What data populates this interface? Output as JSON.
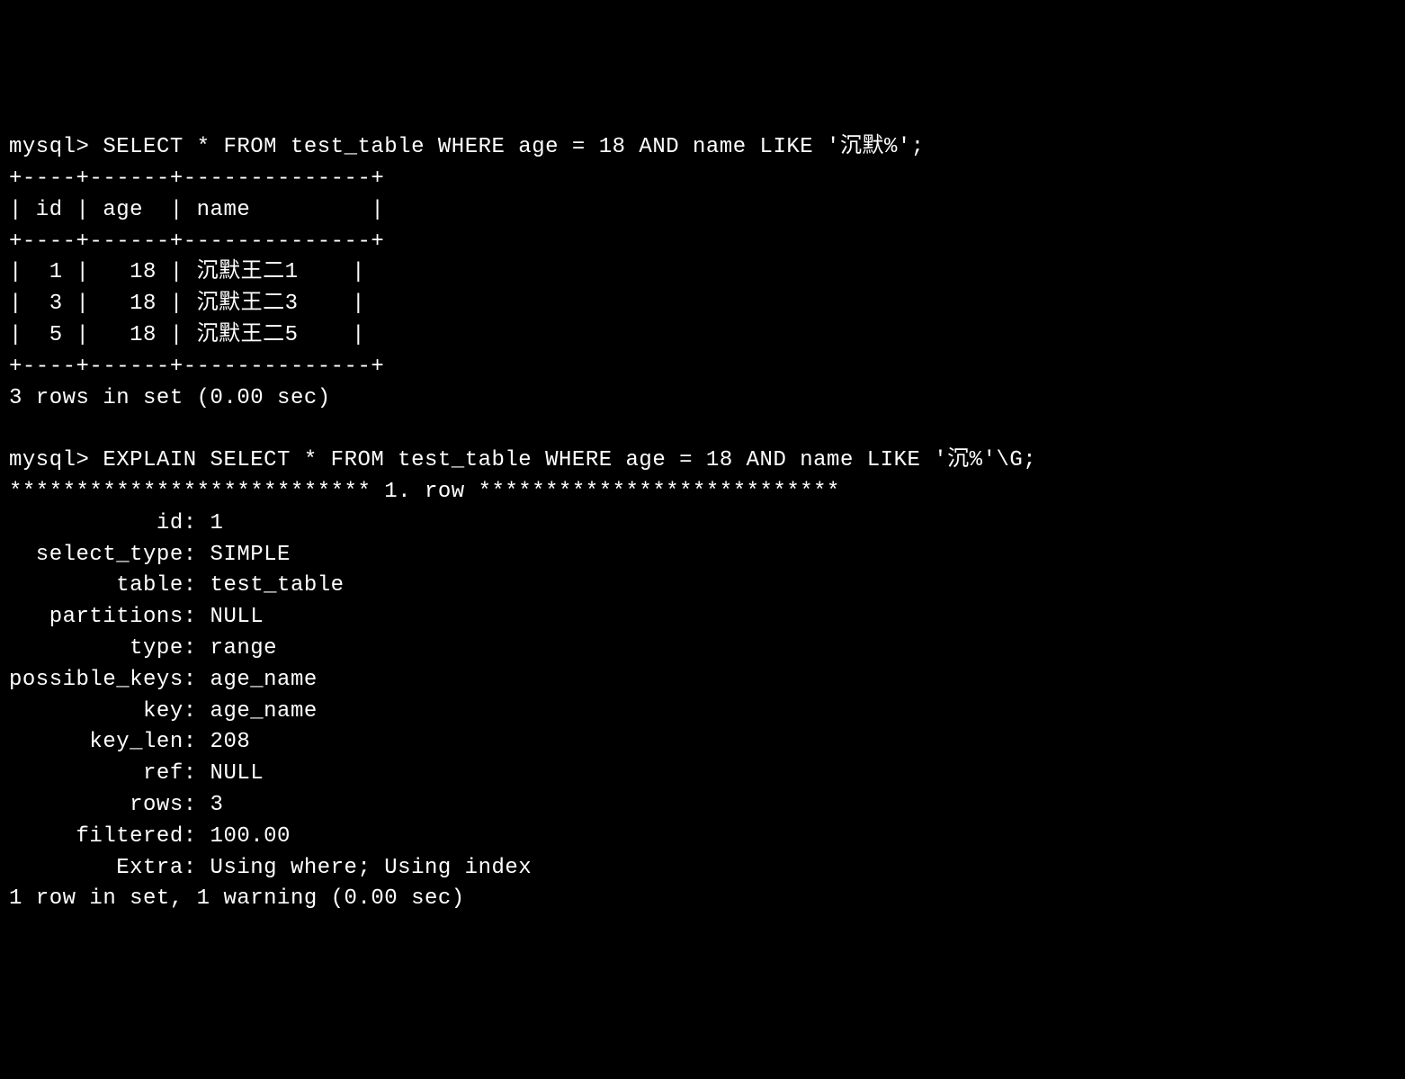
{
  "query1": {
    "prompt": "mysql> ",
    "sql": "SELECT * FROM test_table WHERE age = 18 AND name LIKE '沉默%';",
    "table": {
      "border_top": "+----+------+--------------+",
      "header": "| id | age  | name         |",
      "border_mid": "+----+------+--------------+",
      "rows": [
        "|  1 |   18 | 沉默王二1    |",
        "|  3 |   18 | 沉默王二3    |",
        "|  5 |   18 | 沉默王二5    |"
      ],
      "border_bot": "+----+------+--------------+"
    },
    "summary": "3 rows in set (0.00 sec)"
  },
  "query2": {
    "prompt": "mysql> ",
    "sql": "EXPLAIN SELECT * FROM test_table WHERE age = 18 AND name LIKE '沉%'\\G;",
    "row_header": "*************************** 1. row ***************************",
    "fields": [
      "           id: 1",
      "  select_type: SIMPLE",
      "        table: test_table",
      "   partitions: NULL",
      "         type: range",
      "possible_keys: age_name",
      "          key: age_name",
      "      key_len: 208",
      "          ref: NULL",
      "         rows: 3",
      "     filtered: 100.00",
      "        Extra: Using where; Using index"
    ],
    "summary": "1 row in set, 1 warning (0.00 sec)"
  }
}
